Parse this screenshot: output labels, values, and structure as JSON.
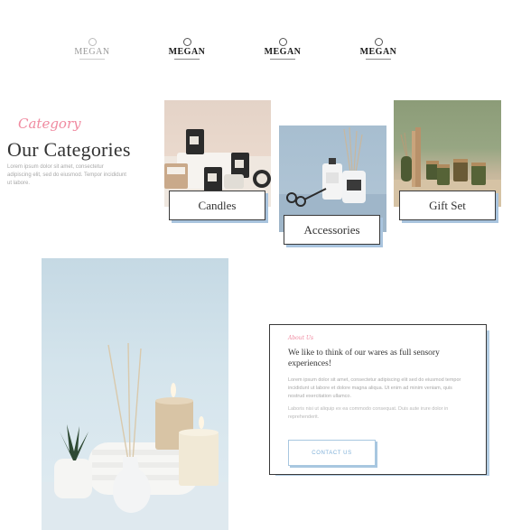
{
  "logos": [
    {
      "name": "MEGAN"
    },
    {
      "name": "MEGAN"
    },
    {
      "name": "MEGAN"
    },
    {
      "name": "MEGAN"
    }
  ],
  "categories_section": {
    "eyebrow": "Category",
    "title": "Our Categories",
    "lead": "Lorem ipsum dolor sit amet, consectetur adipiscing elit, sed do eiusmod. Tempor incididunt ut labore.",
    "cards": [
      {
        "label": "Candles"
      },
      {
        "label": "Accessories"
      },
      {
        "label": "Gift Set"
      }
    ]
  },
  "about": {
    "eyebrow": "About Us",
    "heading": "We like to think of our wares as full sensory experiences!",
    "text": "Lorem ipsum dolor sit amet, consectetur adipiscing elit sed do eiusmod tempor incididunt ut labore et dolore magna aliqua. Ut enim ad minim veniam, quis nostrud exercitation ullamco.",
    "text2": "Laboris nisi ut aliquip ex ea commodo consequat. Duis aute irure dolor in reprehenderit.",
    "button": "CONTACT US"
  },
  "colors": {
    "accent_pink": "#f08aa0",
    "accent_blue": "#a9c4de"
  }
}
